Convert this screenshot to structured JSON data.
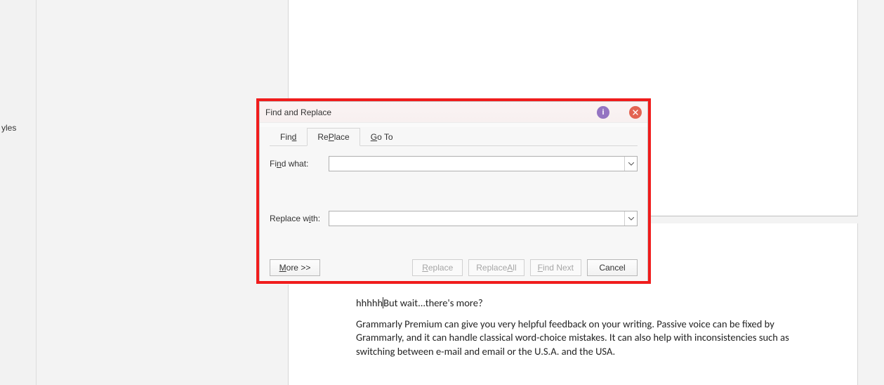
{
  "sidebar": {
    "truncated_label": "yles"
  },
  "document": {
    "line1_a": "hhhhh",
    "line1_b": "But wait...there's more?",
    "para2": "Grammarly Premium can give you very helpful feedback on your writing. Passive voice can be fixed by Grammarly, and it can handle classical word-choice mistakes. It can also help with inconsistencies such as switching between e-mail and email or the U.S.A. and the USA."
  },
  "dialog": {
    "title": "Find and Replace",
    "help_glyph": "i",
    "tabs": {
      "find": {
        "mn": "d",
        "pre": "Fin",
        "post": ""
      },
      "replace": {
        "mn": "P",
        "pre": "Re",
        "post": "lace"
      },
      "goto": {
        "mn": "G",
        "pre": "",
        "post": "o To"
      }
    },
    "find_label": {
      "pre": "Fi",
      "mn": "n",
      "post": "d what:"
    },
    "find_value": "",
    "replace_label": {
      "pre": "Replace w",
      "mn": "i",
      "post": "th:"
    },
    "replace_value": "",
    "buttons": {
      "more": {
        "mn": "M",
        "pre": "",
        "post": "ore >>"
      },
      "replace": {
        "mn": "R",
        "pre": "",
        "post": "eplace"
      },
      "replace_all": {
        "mn": "A",
        "pre": "Replace ",
        "post": "ll"
      },
      "find_next": {
        "mn": "F",
        "pre": "",
        "post": "ind Next"
      },
      "cancel": "Cancel"
    }
  }
}
